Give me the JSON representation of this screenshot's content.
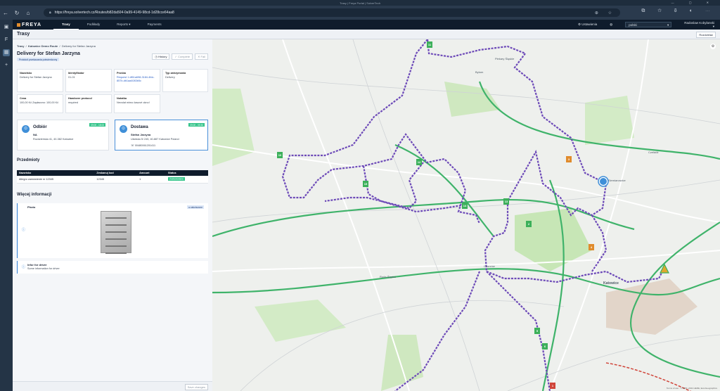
{
  "window": {
    "title": "Trasy | Freya Portal | SolverTech"
  },
  "browser": {
    "url": "https://freya.solvertech.cz/Routes/b82da504-0a99-4149-98cd-1d28cce64aa8"
  },
  "app": {
    "logo": "FREYA",
    "menu": [
      "Trasy",
      "Podkłady",
      "Reports",
      "Payments"
    ],
    "settings_label": "Ustawienia",
    "language": "polski",
    "user": "Radoslaw Kobylanski"
  },
  "page": {
    "title": "Trasy",
    "button": "Rozdzielać"
  },
  "breadcrumb": [
    "Trasy",
    "Katowice Demo Route",
    "Delivery for Stefan Jarzyna"
  ],
  "detail": {
    "title": "Delivery for Stefan Jarzyna",
    "tag": "Protokół przekazania potwierdzony",
    "actions": {
      "history": "History",
      "complete": "Complete",
      "fail": "Fail"
    },
    "fields": [
      {
        "label": "Nazwisko",
        "value": "Delivery for Stefan Jarzyna"
      },
      {
        "label": "Identyfikator",
        "value": "01-01"
      },
      {
        "label": "Prośba",
        "value": "Request 1 df61a698-3184-4fdc-857b-db1aa4083b5c"
      },
      {
        "label": "Typ zatrzymania",
        "value": "Delivery"
      },
      {
        "label": "Cena",
        "value": "100,00 Kč Zapłacono: 100,00 Kč"
      },
      {
        "label": "Handover protocol",
        "value": "required"
      },
      {
        "label": "Notatka",
        "value": "Nevolat mimo časové okno!"
      }
    ],
    "pickup": {
      "title": "Odbiór",
      "time": "09:00 - 18:00",
      "name": "NA",
      "address": "Rozdzieńska 41, 40-382 Katowice"
    },
    "delivery": {
      "title": "Dostawa",
      "time": "09:00 - 09:30",
      "name": "Stefan Jarzyna",
      "address": "Ułańska 5/ 245, 40-887 Katowice Poland",
      "phone": "00480061201411"
    }
  },
  "items": {
    "title": "Przedmioty",
    "columns": [
      "Nazwisko",
      "Zeskanuj kod",
      "Amount",
      "Status"
    ],
    "rows": [
      {
        "name": "Allegro zamówienie nr 12345",
        "code": "12345",
        "amount": "1",
        "status": "Zeskanowane"
      }
    ]
  },
  "more": {
    "title": "Więcej informacji",
    "photo": {
      "label": "Photo",
      "tag": "zakończone"
    },
    "driver": {
      "label": "Infor for driver",
      "text": "Some information for driver"
    }
  },
  "save": "Save changes",
  "map": {
    "labels": [
      "Bytom",
      "Piekary Śląskie",
      "Czeladź",
      "Siemianowice",
      "Chorzów",
      "Ruda Śląska",
      "Katowice"
    ],
    "footer": "Terms of use · © 1987–2024 HERE, EuroGeographics"
  }
}
